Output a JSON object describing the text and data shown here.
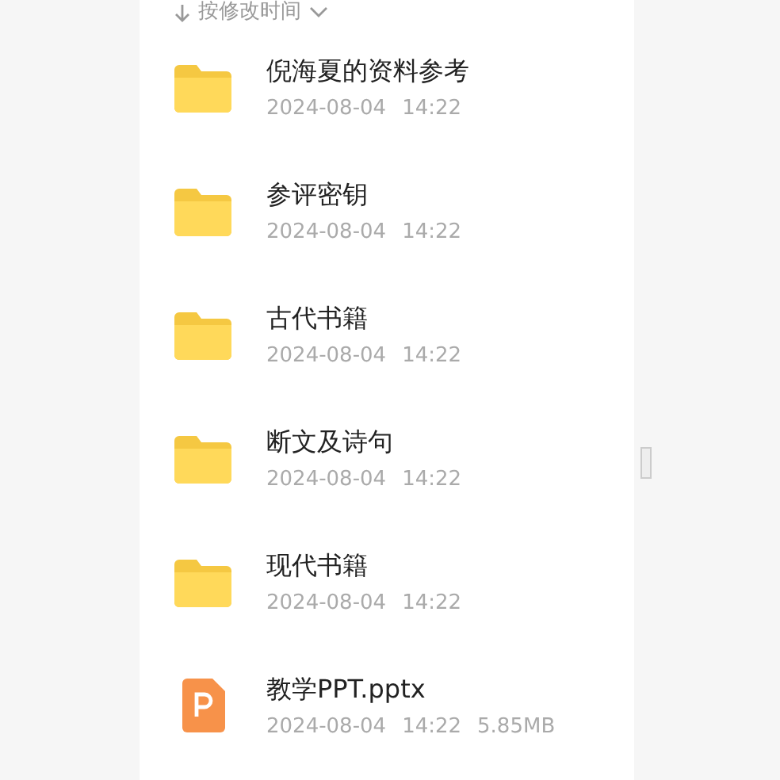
{
  "sort": {
    "label": "按修改时间"
  },
  "files": [
    {
      "kind": "folder",
      "name": "倪海夏的资料参考",
      "date": "2024-08-04",
      "time": "14:22"
    },
    {
      "kind": "folder",
      "name": "参评密钥",
      "date": "2024-08-04",
      "time": "14:22"
    },
    {
      "kind": "folder",
      "name": "古代书籍",
      "date": "2024-08-04",
      "time": "14:22"
    },
    {
      "kind": "folder",
      "name": "断文及诗句",
      "date": "2024-08-04",
      "time": "14:22"
    },
    {
      "kind": "folder",
      "name": "现代书籍",
      "date": "2024-08-04",
      "time": "14:22"
    },
    {
      "kind": "ppt",
      "name": "教学PPT.pptx",
      "date": "2024-08-04",
      "time": "14:22",
      "size": "5.85MB"
    }
  ]
}
